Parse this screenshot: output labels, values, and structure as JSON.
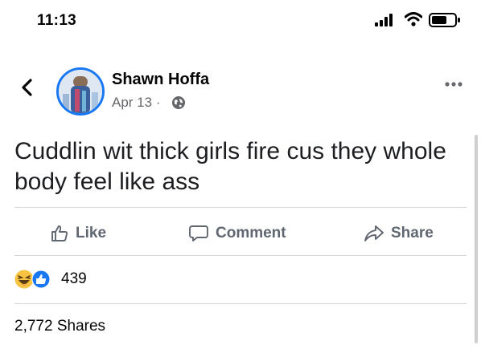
{
  "status_bar": {
    "time": "11:13"
  },
  "post": {
    "author": "Shawn Hoffa",
    "date": "Apr 13",
    "date_separator": "·",
    "text": "Cuddlin wit thick girls fire cus they whole body feel like ass",
    "privacy_icon": "globe-icon"
  },
  "actions": {
    "like": "Like",
    "comment": "Comment",
    "share": "Share"
  },
  "reactions": {
    "count": "439",
    "icons": [
      "haha-icon",
      "like-icon"
    ]
  },
  "shares": "2,772 Shares",
  "colors": {
    "accent": "#1877f2",
    "muted": "#65676b",
    "divider": "#d6d6d6"
  }
}
